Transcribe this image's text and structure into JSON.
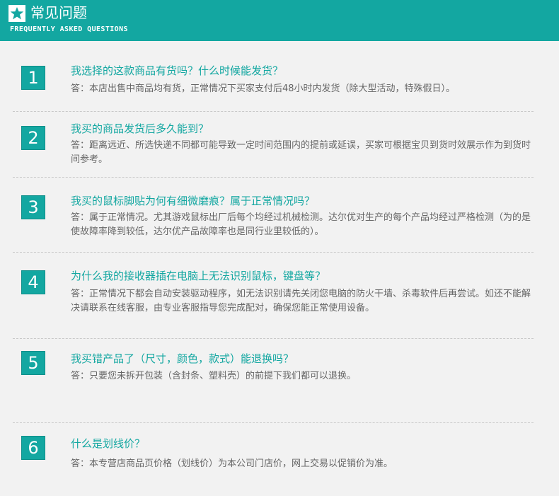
{
  "header": {
    "title": "常见问题",
    "subtitle": "FREQUENTLY ASKED QUESTIONS",
    "icon": "star-icon",
    "accent_color": "#13a7a1"
  },
  "faq": [
    {
      "number": "1",
      "question": "我选择的这款商品有货吗？什么时候能发货？",
      "answer": "答：本店出售中商品均有货，正常情况下买家支付后48小时内发货（除大型活动，特殊假日）。"
    },
    {
      "number": "2",
      "question": "我买的商品发货后多久能到？",
      "answer": "答：距离远近、所选快递不同都可能导致一定时间范围内的提前或延误，买家可根据宝贝到货时效展示作为到货时间参考。"
    },
    {
      "number": "3",
      "question": "我买的鼠标脚贴为何有细微磨痕？属于正常情况吗？",
      "answer": "答：属于正常情况。尤其游戏鼠标出厂后每个均经过机械检测。达尔优对生产的每个产品均经过严格检测（为的是使故障率降到较低，达尔优产品故障率也是同行业里较低的）。"
    },
    {
      "number": "4",
      "question": "为什么我的接收器插在电脑上无法识别鼠标，键盘等？",
      "answer": "答：正常情况下都会自动安装驱动程序，如无法识别请先关闭您电脑的防火干墙、杀毒软件后再尝试。如还不能解决请联系在线客服，由专业客服指导您完成配对，确保您能正常使用设备。"
    },
    {
      "number": "5",
      "question": "我买错产品了（尺寸，颜色，款式）能退换吗？",
      "answer": "答：只要您未拆开包装（含封条、塑料壳）的前提下我们都可以退换。"
    },
    {
      "number": "6",
      "question": "什么是划线价？",
      "answer": "答：本专营店商品页价格（划线价）为本公司门店价，网上交易以促销价为准。"
    }
  ]
}
